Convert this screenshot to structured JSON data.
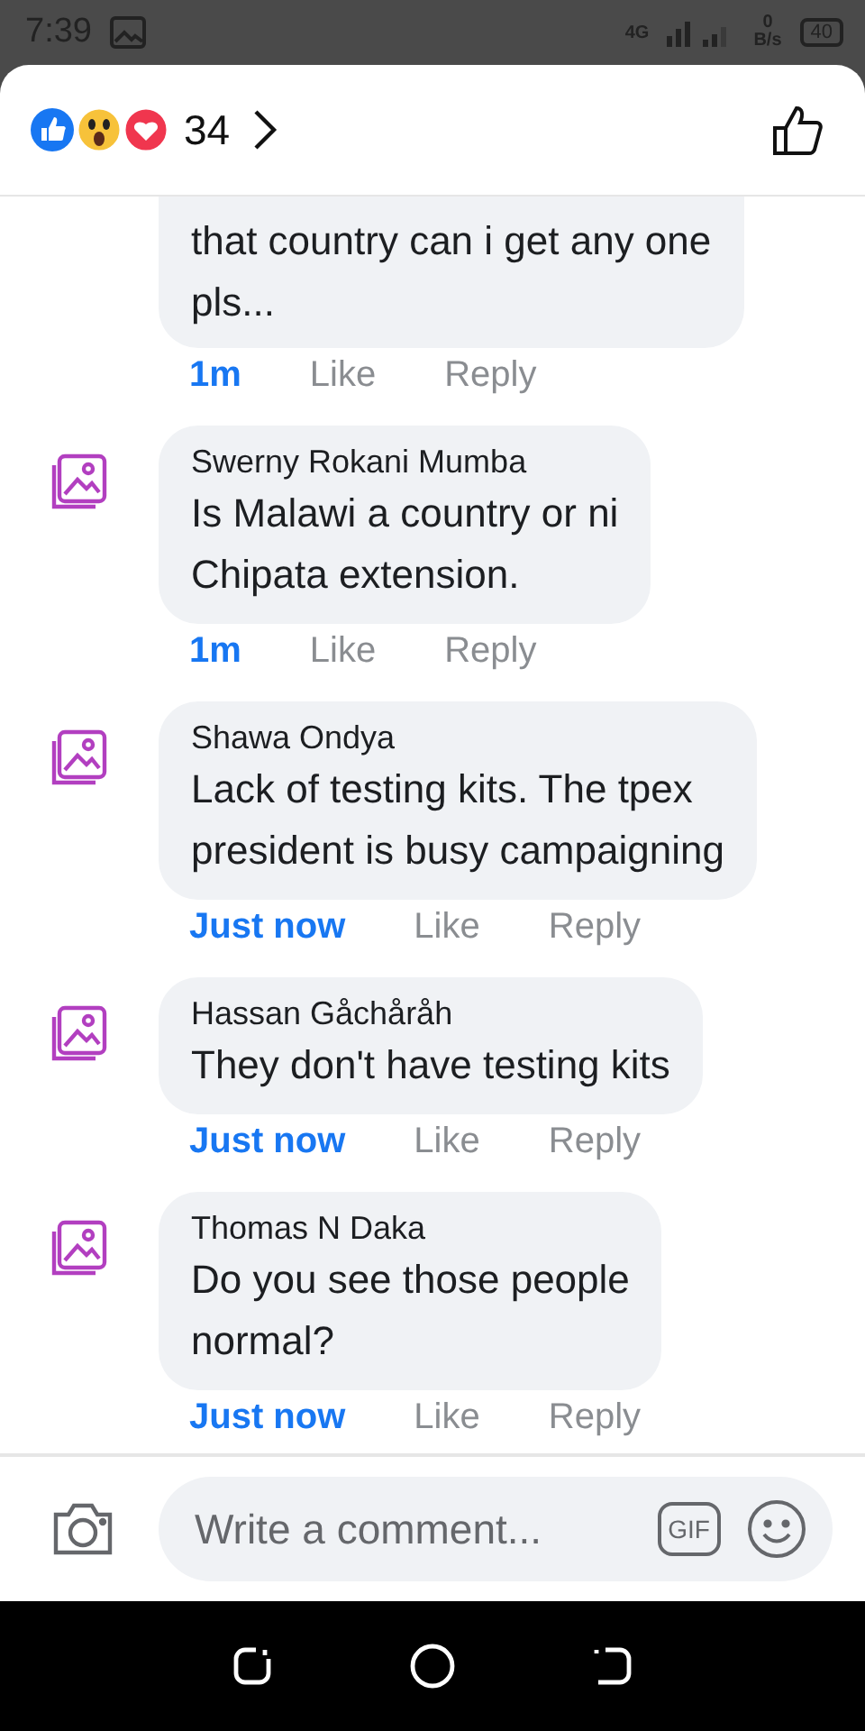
{
  "status_bar": {
    "time": "7:39",
    "network": "4G",
    "speed_value": "0",
    "speed_unit": "B/s",
    "battery": "40"
  },
  "header": {
    "reaction_count": "34"
  },
  "comments": [
    {
      "lines": [
        "that country can i get any one",
        "pls..."
      ],
      "time": "1m",
      "like": "Like",
      "reply": "Reply"
    },
    {
      "name": "Swerny Rokani Mumba",
      "lines": [
        "Is Malawi a country or ni",
        "Chipata extension."
      ],
      "time": "1m",
      "like": "Like",
      "reply": "Reply"
    },
    {
      "name": "Shawa Ondya",
      "lines": [
        "Lack of testing kits. The tpex",
        "president is busy campaigning"
      ],
      "time": "Just now",
      "like": "Like",
      "reply": "Reply"
    },
    {
      "name": "Hassan Gåchåråh",
      "lines": [
        "They don't have testing kits"
      ],
      "time": "Just now",
      "like": "Like",
      "reply": "Reply"
    },
    {
      "name": "Thomas N Daka",
      "lines": [
        "Do you see those people",
        "normal?"
      ],
      "time": "Just now",
      "like": "Like",
      "reply": "Reply"
    }
  ],
  "composer": {
    "placeholder": "Write a comment...",
    "gif_label": "GIF"
  }
}
